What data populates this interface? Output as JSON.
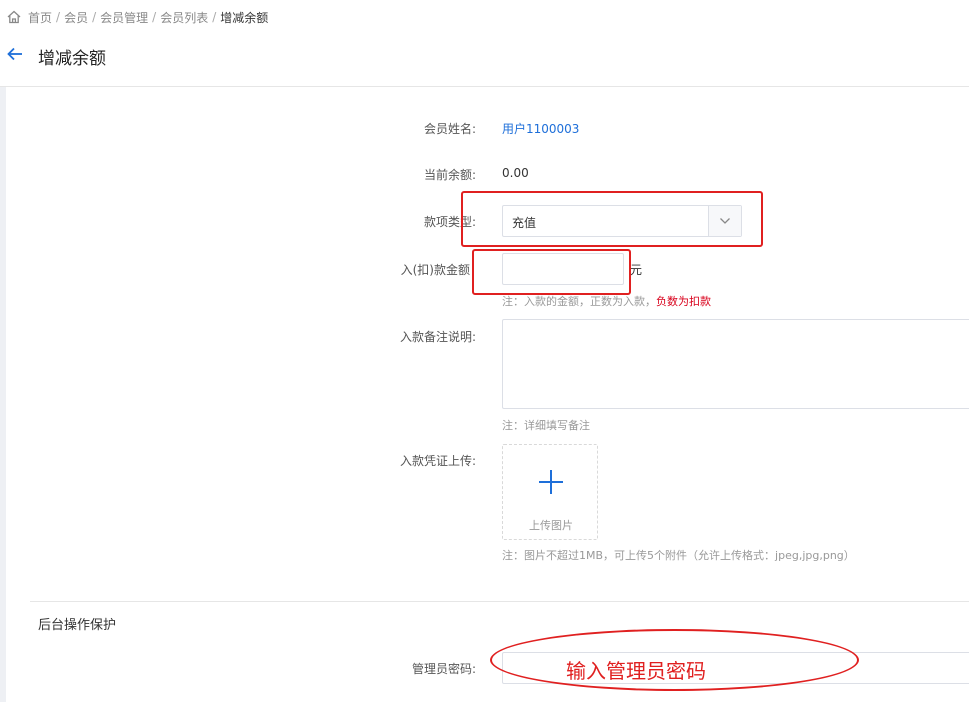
{
  "breadcrumb": {
    "items": [
      "首页",
      "会员",
      "会员管理",
      "会员列表",
      "增减余额"
    ],
    "separator": "/"
  },
  "page": {
    "title": "增减余额",
    "back_icon": "arrow-left-icon",
    "home_icon": "home-icon"
  },
  "form": {
    "member_name": {
      "label": "会员姓名:",
      "value": "用户1100003"
    },
    "balance": {
      "label": "当前余额:",
      "value": "0.00"
    },
    "type": {
      "label": "款项类型:",
      "selected": "充值"
    },
    "amount": {
      "label": "入(扣)款金额",
      "value": "",
      "unit": "元",
      "note_prefix": "注：入款的金额，正数为入款，",
      "note_highlight": "负数为扣款"
    },
    "remark": {
      "label": "入款备注说明:",
      "value": "",
      "note": "注：详细填写备注"
    },
    "upload": {
      "label": "入款凭证上传:",
      "button_text": "上传图片",
      "note": "注：图片不超过1MB，可上传5个附件（允许上传格式：jpeg,jpg,png）"
    }
  },
  "protection": {
    "title": "后台操作保护",
    "password_label": "管理员密码:",
    "password_value": ""
  },
  "annotation": {
    "password_hint": "输入管理员密码",
    "color": "#e02020"
  },
  "colors": {
    "link": "#1e6fd9",
    "accent": "#1e6fd9",
    "danger": "#d9001b"
  }
}
